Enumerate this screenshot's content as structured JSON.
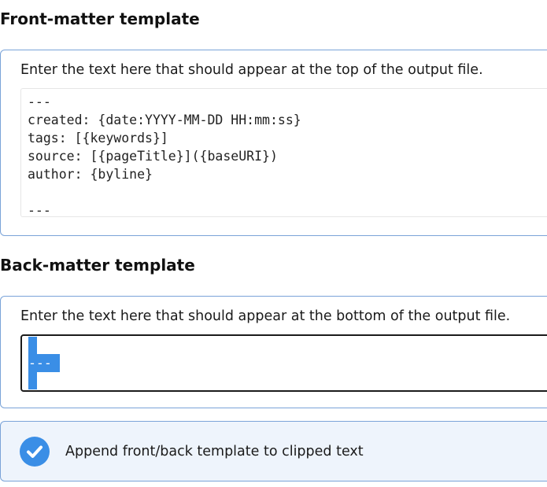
{
  "front_matter": {
    "heading": "Front-matter template",
    "description": "Enter the text here that should appear at the top of the output file.",
    "template_text": "---\ncreated: {date:YYYY-MM-DD HH:mm:ss}\ntags: [{keywords}]\nsource: [{pageTitle}]({baseURI})\nauthor: {byline}\n\n---"
  },
  "back_matter": {
    "heading": "Back-matter template",
    "description": "Enter the text here that should appear at the bottom of the output file.",
    "template_text": "---",
    "selection": "all text selected"
  },
  "options": {
    "append_templates": {
      "label": "Append front/back template to clipped text",
      "checked": true,
      "icon": "checkmark-icon"
    }
  },
  "colors": {
    "accent": "#3a8ee6",
    "panel_border": "#7aa3d8",
    "option_background": "#eef4fc"
  }
}
